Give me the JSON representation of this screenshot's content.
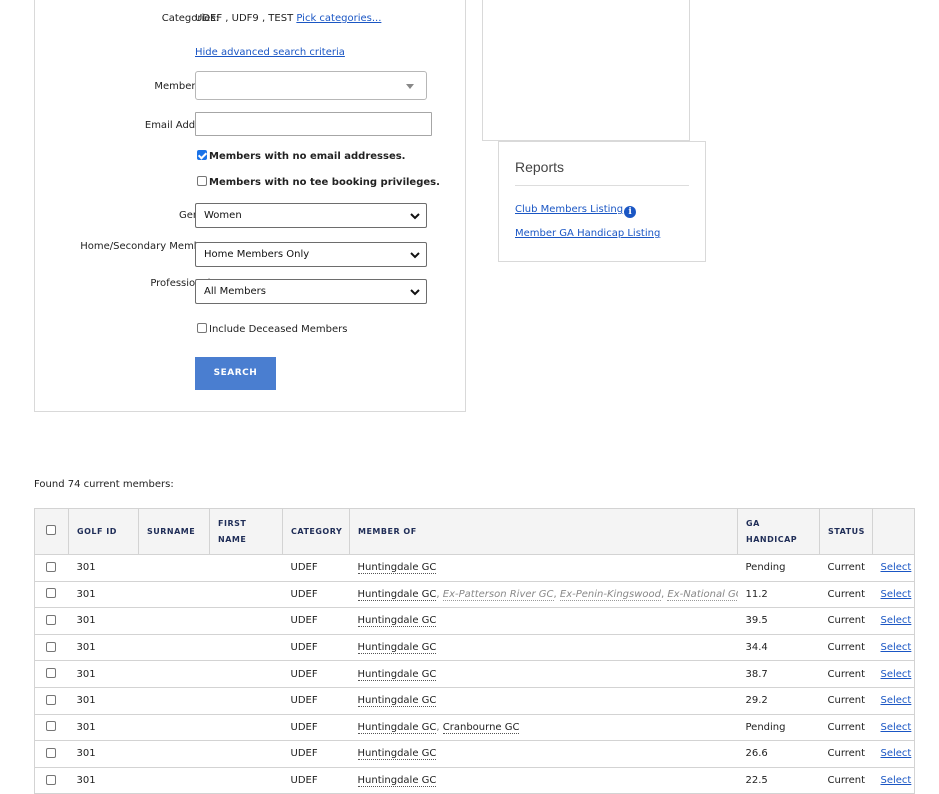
{
  "search": {
    "categories_label": "Categories:",
    "categories_value": "UDEF , UDF9 , TEST",
    "pick_categories": "Pick categories...",
    "hide_advanced": "Hide advanced search criteria",
    "member_tag_label": "Member Tag:",
    "member_tag_value": "",
    "email_label": "Email Address:",
    "email_value": "",
    "no_email_label": "Members with no email addresses.",
    "no_email_checked": true,
    "no_tee_label": "Members with no tee booking privileges.",
    "no_tee_checked": false,
    "gender_label": "Gender:",
    "gender_value": "Women",
    "home_secondary_label": "Home/Secondary Members:",
    "home_secondary_value": "Home Members Only",
    "professionals_label": "Professionals:",
    "professionals_value": "All Members",
    "deceased_label": "Include Deceased Members",
    "deceased_checked": false,
    "search_button": "SEARCH"
  },
  "reports": {
    "title": "Reports",
    "links": [
      "Club Members Listing",
      "Member GA Handicap Listing"
    ],
    "info_glyph": "i"
  },
  "results": {
    "found_text": "Found 74 current members:",
    "columns": [
      "GOLF ID",
      "SURNAME",
      "FIRST NAME",
      "CATEGORY",
      "MEMBER OF",
      "GA HANDICAP",
      "STATUS"
    ],
    "first_name_lines": [
      "FIRST",
      "NAME"
    ],
    "ga_handicap_lines": [
      "GA",
      "HANDICAP"
    ],
    "select_label": "Select",
    "rows": [
      {
        "golf_id": "301",
        "surname": "",
        "first_name": "",
        "category": "UDEF",
        "member_of": "Huntingdale GC",
        "others": [],
        "handicap": "Pending",
        "status": "Current"
      },
      {
        "golf_id": "301",
        "surname": "",
        "first_name": "",
        "category": "UDEF",
        "member_of": "Huntingdale GC",
        "others": [
          "Ex-Patterson River GC",
          "Ex-Penin-Kingswood",
          "Ex-National GC - LI"
        ],
        "handicap": "11.2",
        "status": "Current"
      },
      {
        "golf_id": "301",
        "surname": "",
        "first_name": "",
        "category": "UDEF",
        "member_of": "Huntingdale GC",
        "others": [],
        "handicap": "39.5",
        "status": "Current"
      },
      {
        "golf_id": "301",
        "surname": "",
        "first_name": "",
        "category": "UDEF",
        "member_of": "Huntingdale GC",
        "others": [],
        "handicap": "34.4",
        "status": "Current"
      },
      {
        "golf_id": "301",
        "surname": "",
        "first_name": "",
        "category": "UDEF",
        "member_of": "Huntingdale GC",
        "others": [],
        "handicap": "38.7",
        "status": "Current"
      },
      {
        "golf_id": "301",
        "surname": "",
        "first_name": "",
        "category": "UDEF",
        "member_of": "Huntingdale GC",
        "others": [],
        "handicap": "29.2",
        "status": "Current"
      },
      {
        "golf_id": "301",
        "surname": "",
        "first_name": "",
        "category": "UDEF",
        "member_of": "Huntingdale GC",
        "others_plain": [
          "Cranbourne GC"
        ],
        "others": [],
        "handicap": "Pending",
        "status": "Current"
      },
      {
        "golf_id": "301",
        "surname": "",
        "first_name": "",
        "category": "UDEF",
        "member_of": "Huntingdale GC",
        "others": [],
        "handicap": "26.6",
        "status": "Current"
      },
      {
        "golf_id": "301",
        "surname": "",
        "first_name": "",
        "category": "UDEF",
        "member_of": "Huntingdale GC",
        "others": [],
        "handicap": "22.5",
        "status": "Current"
      }
    ]
  },
  "colors": {
    "link": "#1a56c4",
    "search_button": "#4a7ed0",
    "header_text": "#1f2d57",
    "checkbox_checked": "#1a73e8"
  }
}
